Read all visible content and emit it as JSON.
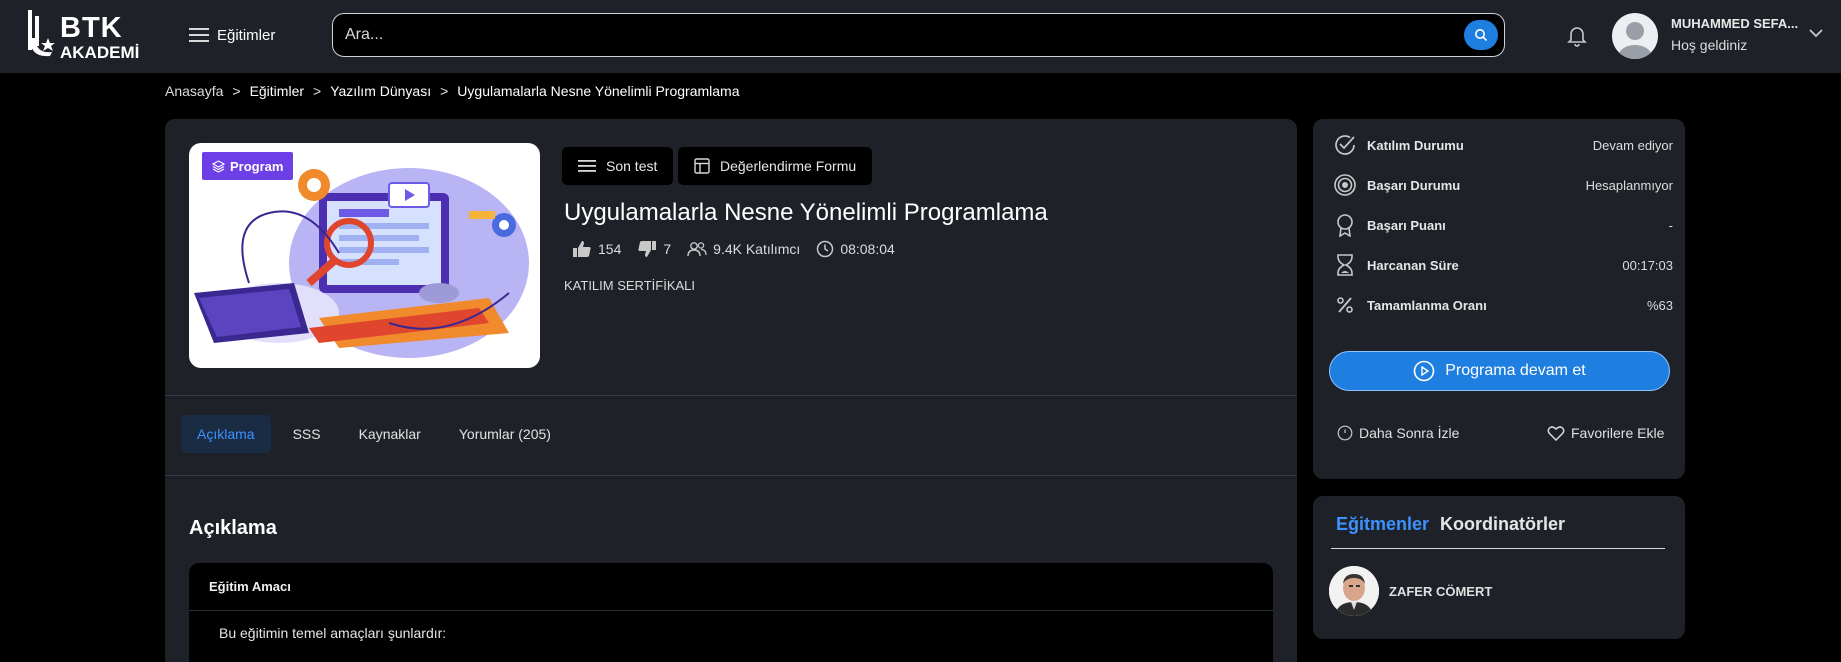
{
  "header": {
    "logo_line1": "BTK",
    "logo_line2": "AKADEMİ",
    "menu_label": "Eğitimler",
    "search_placeholder": "Ara...",
    "user_name": "MUHAMMED SEFA...",
    "user_greeting": "Hoş geldiniz"
  },
  "breadcrumb": [
    "Anasayfa",
    "Eğitimler",
    "Yazılım Dünyası",
    "Uygulamalarla Nesne Yönelimli Programlama"
  ],
  "breadcrumb_sep": ">",
  "course": {
    "badge": "Program",
    "title": "Uygulamalarla Nesne Yönelimli Programlama",
    "likes": "154",
    "dislikes": "7",
    "participants": "9.4K Katılımcı",
    "duration": "08:08:04",
    "certificate": "KATILIM SERTİFİKALI",
    "buttons": {
      "final_test": "Son test",
      "eval_form": "Değerlendirme Formu"
    }
  },
  "tabs": [
    {
      "label": "Açıklama",
      "active": true
    },
    {
      "label": "SSS",
      "active": false
    },
    {
      "label": "Kaynaklar",
      "active": false
    },
    {
      "label": "Yorumlar (205)",
      "active": false
    }
  ],
  "description": {
    "title": "Açıklama",
    "box_title": "Eğitim Amacı",
    "text": "Bu eğitimin temel amaçları şunlardır:"
  },
  "status": {
    "participation_label": "Katılım Durumu",
    "participation_value": "Devam ediyor",
    "success_label": "Başarı Durumu",
    "success_value": "Hesaplanmıyor",
    "score_label": "Başarı Puanı",
    "score_value": "-",
    "time_label": "Harcanan Süre",
    "time_value": "00:17:03",
    "completion_label": "Tamamlanma Oranı",
    "completion_value": "%63",
    "continue_button": "Programa devam et",
    "watch_later": "Daha Sonra İzle",
    "add_favorites": "Favorilere Ekle"
  },
  "people": {
    "tab_instructors": "Eğitmenler",
    "tab_coordinators": "Koordinatörler",
    "instructor_name": "ZAFER CÖMERT"
  },
  "colors": {
    "accent": "#1f7fe0",
    "card": "#1e2228",
    "badge": "#6d3fe6"
  }
}
